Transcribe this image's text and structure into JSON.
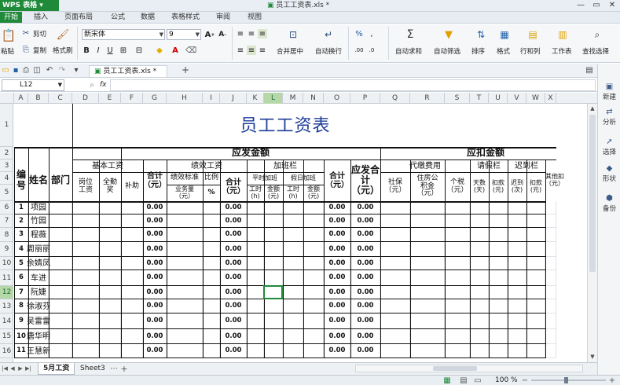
{
  "app": {
    "name": "WPS 表格",
    "doc_title": "员工工资表.xls *"
  },
  "ribbon_tabs": [
    "开始",
    "插入",
    "页面布局",
    "公式",
    "数据",
    "表格样式",
    "审阅",
    "视图"
  ],
  "ribbon": {
    "paste": "粘贴",
    "cut": "剪切",
    "copy": "复制",
    "format_painter": "格式刷",
    "font_name": "新宋体",
    "font_size": "9",
    "merge_center": "合并居中",
    "wrap_text": "自动换行",
    "autosum": "自动求和",
    "autofilter": "自动筛选",
    "sort": "排序",
    "format": "格式",
    "rows_cols": "行和列",
    "worksheet": "工作表",
    "find_select": "查找选择"
  },
  "file_tab": "员工工资表.xls *",
  "name_box": "L12",
  "fx_label": "fx",
  "columns": [
    "A",
    "B",
    "C",
    "D",
    "E",
    "F",
    "G",
    "H",
    "I",
    "J",
    "K",
    "L",
    "M",
    "N",
    "O",
    "P",
    "Q",
    "R",
    "S",
    "T",
    "U",
    "V",
    "W",
    "X"
  ],
  "selected_column": "L",
  "row_numbers": [
    "1",
    "2",
    "3",
    "4",
    "5",
    "6",
    "7",
    "8",
    "9",
    "10",
    "11",
    "12",
    "13",
    "14",
    "15",
    "16"
  ],
  "selected_row": "12",
  "sheet": {
    "title": "员工工资表",
    "should_pay": "应发金额",
    "deduct": "应扣金额",
    "col_no": "编号",
    "col_name": "姓名",
    "col_dept": "部门",
    "basic_wage": "基本工资",
    "post_wage": "岗位工资",
    "attendance": "全勤奖",
    "allowance": "补助",
    "subtotal": "合计（元）",
    "performance": "绩效工资",
    "perf_standard": "绩效标准",
    "perf_ratio": "比例",
    "business_volume": "业务量（元）",
    "percent": "%",
    "overtime": "加班栏",
    "weekday_ot": "平时加班",
    "holiday_ot": "假日加班",
    "hours": "工时(h)",
    "amount": "金额(元)",
    "payable_total": "应发合计（元）",
    "withheld": "代缴费用",
    "social_security": "社保（元）",
    "housing_fund": "住房公积金（元）",
    "income_tax": "个税（元）",
    "leave": "请假栏",
    "days": "天数(天)",
    "deduction": "扣款(元)",
    "late": "迟到栏",
    "late_times": "迟到(次)",
    "other_deduct": "其他扣（元）"
  },
  "rows": [
    {
      "no": "1",
      "name": "项园",
      "g": "0.00",
      "j": "0.00",
      "o": "0.00",
      "p": "0.00"
    },
    {
      "no": "2",
      "name": "竹园",
      "g": "0.00",
      "j": "0.00",
      "o": "0.00",
      "p": "0.00"
    },
    {
      "no": "3",
      "name": "程薇",
      "g": "0.00",
      "j": "0.00",
      "o": "0.00",
      "p": "0.00"
    },
    {
      "no": "4",
      "name": "周丽丽",
      "g": "0.00",
      "j": "0.00",
      "o": "0.00",
      "p": "0.00"
    },
    {
      "no": "5",
      "name": "余婧凤",
      "g": "0.00",
      "j": "0.00",
      "o": "0.00",
      "p": "0.00"
    },
    {
      "no": "6",
      "name": "车进",
      "g": "0.00",
      "j": "0.00",
      "o": "0.00",
      "p": "0.00"
    },
    {
      "no": "7",
      "name": "阮婕",
      "g": "0.00",
      "j": "0.00",
      "o": "0.00",
      "p": "0.00"
    },
    {
      "no": "8",
      "name": "徐淑芬",
      "g": "0.00",
      "j": "0.00",
      "o": "0.00",
      "p": "0.00"
    },
    {
      "no": "9",
      "name": "吴雷雷",
      "g": "0.00",
      "j": "0.00",
      "o": "0.00",
      "p": "0.00"
    },
    {
      "no": "10",
      "name": "唐华明",
      "g": "0.00",
      "j": "0.00",
      "o": "0.00",
      "p": "0.00"
    },
    {
      "no": "11",
      "name": "王慧新",
      "g": "0.00",
      "j": "0.00",
      "o": "0.00",
      "p": "0.00"
    }
  ],
  "sheet_tabs": [
    "5月工资",
    "Sheet3"
  ],
  "status": {
    "zoom": "100 %"
  },
  "right_panel": [
    "新建",
    "分析",
    "选择",
    "形状",
    "备份"
  ]
}
